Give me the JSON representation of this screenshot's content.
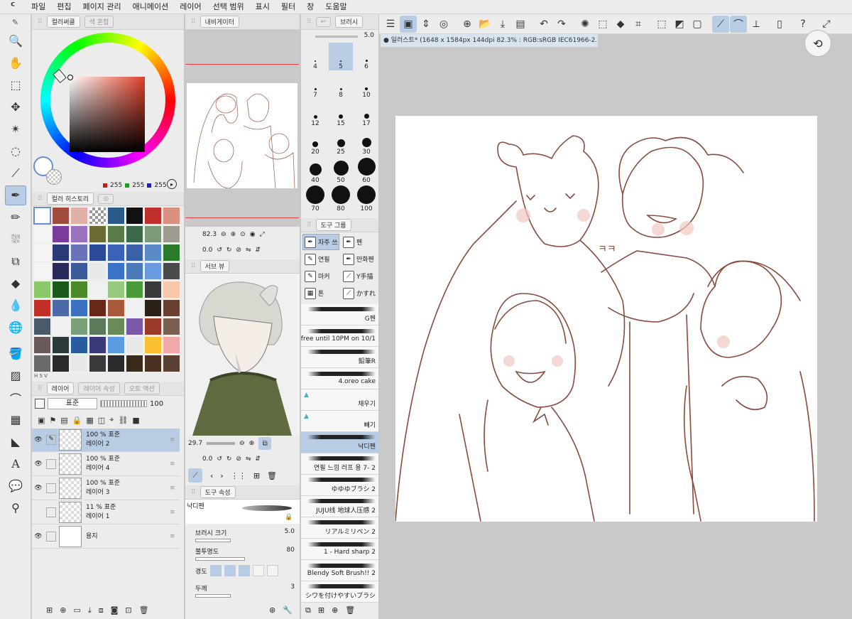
{
  "menu": {
    "logo": "ᑦ",
    "items": [
      "파일",
      "편집",
      "페이지 관리",
      "애니메이션",
      "레이어",
      "선택 범위",
      "표시",
      "필터",
      "창",
      "도움말"
    ]
  },
  "colors": {
    "accent": "#b8cde4",
    "canvas_bg": "#c9c9c9",
    "stroke": "#8a4a3c"
  },
  "color_panel": {
    "tab1": "컬러써클",
    "tab2": "색 혼합",
    "r": "255",
    "g": "255",
    "b": "255"
  },
  "history_panel": {
    "tab": "컬러 히스토리"
  },
  "swatches": [
    "#ffffff",
    "#a04c3c",
    "#e0b0a8",
    "checker",
    "#2a5a8a",
    "#111111",
    "#c0302a",
    "#d99080",
    "#f4f4f4",
    "#7a3d9e",
    "#9a72c0",
    "#6a6a32",
    "#5a7a4a",
    "#3a6a48",
    "#7a9a78",
    "#a09a90",
    "#f4f4f4",
    "#2a3a78",
    "#6a72b8",
    "#2a4a9a",
    "#3a62b8",
    "#3a62a8",
    "#5a8ac8",
    "#2a7a2a",
    "#f4f4f4",
    "#2a2a5a",
    "#3a5a9a",
    "#e8e8e8",
    "#3a72c8",
    "#4a7ab8",
    "#6a9ae0",
    "#4a4a4a",
    "#8ac86a",
    "#1a5a1a",
    "#4a8a2a",
    "#f0f0f0",
    "#98c880",
    "#4a9a3a",
    "#3a3a3a",
    "#f8c8a8",
    "#c03028",
    "#4a6aa8",
    "#3a72c0",
    "#6a2818",
    "#a85a3a",
    "#f0f0f0",
    "#2a2018",
    "#6a4030",
    "#4a5a6a",
    "#f0f0f0",
    "#7aa07a",
    "#5a7a5a",
    "#6a8a5a",
    "#7a5aa8",
    "#9a3a28",
    "#7a6050",
    "#6a5a5a",
    "#2a3a3a",
    "#2a5aa0",
    "#3a3a7a",
    "#5a9ae0",
    "#e8e8e8",
    "#f8c030",
    "#f0a8a8",
    "#6a6a6a",
    "#2a2a2a",
    "#e8e8e8",
    "#3a3a3a",
    "#2a2a2a",
    "#3a2a1a",
    "#4a3020",
    "#5a4030"
  ],
  "layers_panel": {
    "tab1": "레이어",
    "tab2": "레이어 속성",
    "tab3": "오토 액션",
    "blend": "표준",
    "opacity": "100",
    "layers": [
      {
        "pct": "100 %",
        "mode": "표준",
        "name": "레이어 2"
      },
      {
        "pct": "100 %",
        "mode": "표준",
        "name": "레이어 4"
      },
      {
        "pct": "100 %",
        "mode": "표준",
        "name": "레이어 3"
      },
      {
        "pct": "11 %",
        "mode": "표준",
        "name": "레이어 1"
      },
      {
        "pct": "",
        "mode": "",
        "name": "용지"
      }
    ]
  },
  "navigator": {
    "tab": "내비게이터",
    "zoom": "82.3",
    "angle": "0.0"
  },
  "subview": {
    "tab": "서브 뷰",
    "zoom": "29.7",
    "angle": "0.0"
  },
  "tool_prop": {
    "tab": "도구 속성",
    "brush_name": "낙디펜",
    "size_label": "브러시 크기",
    "size": "5.0",
    "opacity_label": "불투명도",
    "opacity": "80",
    "hardness_label": "경도",
    "thickness_label": "두께",
    "thickness": "3"
  },
  "brush_size": {
    "tab": "브러시",
    "current": "5.0",
    "sizes": [
      "4",
      "5",
      "6",
      "7",
      "8",
      "10",
      "12",
      "15",
      "17",
      "20",
      "25",
      "30",
      "40",
      "50",
      "60",
      "70",
      "80",
      "100"
    ]
  },
  "tool_group": {
    "tab": "도구 그룹",
    "groups": [
      [
        "자주 쓰",
        "펜"
      ],
      [
        "연필",
        "만화펜"
      ],
      [
        "마커",
        "Y手描"
      ],
      [
        "톤",
        "かすれ"
      ]
    ]
  },
  "brushes": [
    "G펜",
    "[free until 10PM on 10/1",
    "鉛筆R",
    "4.oreo cake",
    "채우기",
    "빼기",
    "낙디펜",
    "연필 느낌 러프 용 7- 2",
    "ゆゆゆブラシ 2",
    "JUJU线 地球人压感 2",
    "リアルミリペン 2",
    "1 - Hard sharp 2",
    "Blendy Soft Brush!! 2",
    "シワを付けやすいブラシ"
  ],
  "doc": {
    "title": "일러스트* (1648 x 1584px 144dpi 82.3% : RGB:sRGB IEC61966-2.1)",
    "text_kk": "ㅋㅋ"
  }
}
